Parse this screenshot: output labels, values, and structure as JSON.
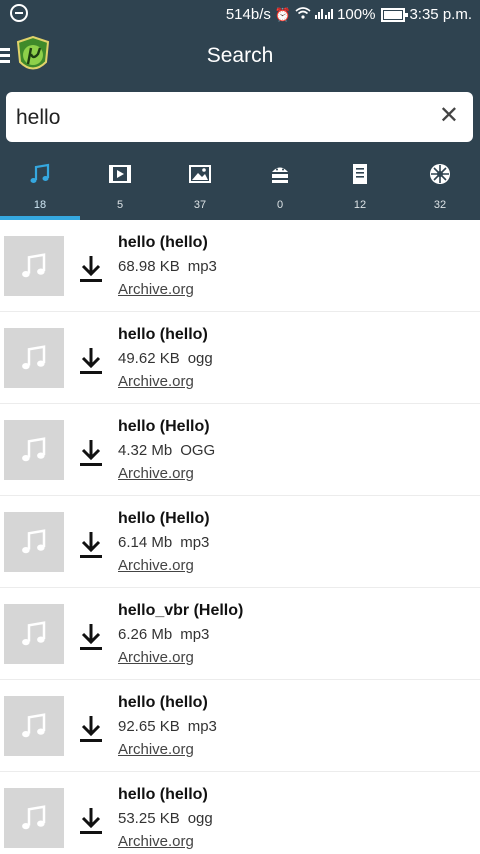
{
  "statusbar": {
    "speed": "514b/s",
    "battery": "100%",
    "time": "3:35 p.m."
  },
  "appbar": {
    "title": "Search"
  },
  "search": {
    "value": "hello",
    "clear_icon": "close-icon"
  },
  "tabs": [
    {
      "icon": "music-icon",
      "count": "18",
      "active": true
    },
    {
      "icon": "video-icon",
      "count": "5"
    },
    {
      "icon": "image-icon",
      "count": "37"
    },
    {
      "icon": "android-icon",
      "count": "0"
    },
    {
      "icon": "document-icon",
      "count": "12"
    },
    {
      "icon": "torrent-icon",
      "count": "32"
    }
  ],
  "results": [
    {
      "title": "hello (hello)",
      "size": "68.98 KB",
      "ext": "mp3",
      "source": "Archive.org"
    },
    {
      "title": "hello (hello)",
      "size": "49.62 KB",
      "ext": "ogg",
      "source": "Archive.org"
    },
    {
      "title": "hello (Hello)",
      "size": "4.32 Mb",
      "ext": "OGG",
      "source": "Archive.org"
    },
    {
      "title": "hello (Hello)",
      "size": "6.14 Mb",
      "ext": "mp3",
      "source": "Archive.org"
    },
    {
      "title": "hello_vbr (Hello)",
      "size": "6.26 Mb",
      "ext": "mp3",
      "source": "Archive.org"
    },
    {
      "title": "hello (hello)",
      "size": "92.65 KB",
      "ext": "mp3",
      "source": "Archive.org"
    },
    {
      "title": "hello (hello)",
      "size": "53.25 KB",
      "ext": "ogg",
      "source": "Archive.org"
    }
  ],
  "colors": {
    "header_bg": "#2f4350",
    "accent": "#35a8e0",
    "thumb_bg": "#d6d6d6"
  }
}
